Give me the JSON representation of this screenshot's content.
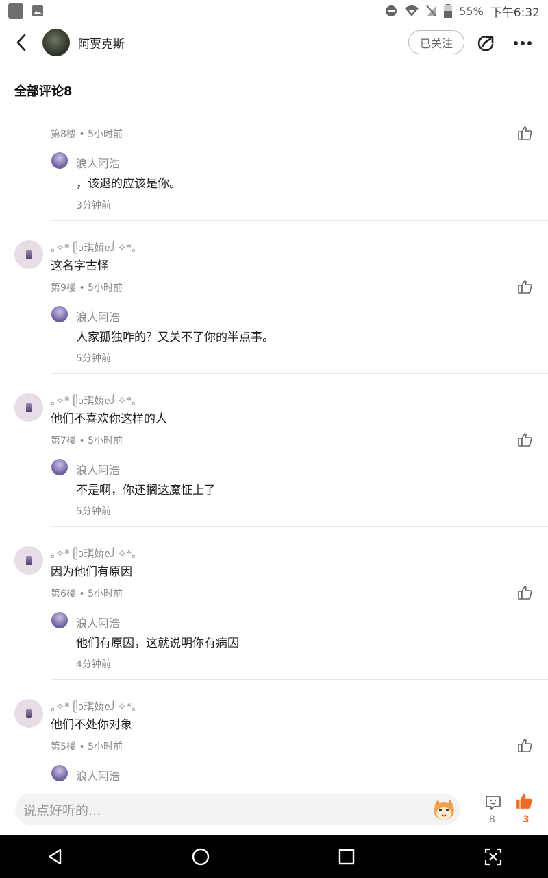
{
  "status_bar": {
    "battery": "55%",
    "time": "下午6:32"
  },
  "header": {
    "username": "阿贾克斯",
    "follow_label": "已关注"
  },
  "section_title": "全部评论8",
  "comments": [
    {
      "user": "",
      "text": "",
      "meta": "第8楼 • 5小时前",
      "reply": {
        "user": "浪人阿浩",
        "text": "，该退的应该是你。",
        "time": "3分钟前"
      }
    },
    {
      "user": "｡✧* ᥫᩣ琪娇ᩓ ✧*｡",
      "text": "这名字古怪",
      "meta": "第9楼 • 5小时前",
      "reply": {
        "user": "浪人阿浩",
        "text": "人家孤独咋的？又关不了你的半点事。",
        "time": "5分钟前"
      }
    },
    {
      "user": "｡✧* ᥫᩣ琪娇ᩓ ✧*｡",
      "text": "他们不喜欢你这样的人",
      "meta": "第7楼 • 5小时前",
      "reply": {
        "user": "浪人阿浩",
        "text": "不是啊，你还搁这魔怔上了",
        "time": "5分钟前"
      }
    },
    {
      "user": "｡✧* ᥫᩣ琪娇ᩓ ✧*｡",
      "text": "因为他们有原因",
      "meta": "第6楼 • 5小时前",
      "reply": {
        "user": "浪人阿浩",
        "text": "他们有原因，这就说明你有病因",
        "time": "4分钟前"
      }
    },
    {
      "user": "｡✧* ᥫᩣ琪娇ᩓ ✧*｡",
      "text": "他们不处你对象",
      "meta": "第5楼 • 5小时前",
      "reply": {
        "user": "浪人阿浩",
        "text": "",
        "time": ""
      }
    }
  ],
  "bottom_bar": {
    "input_placeholder": "说点好听的...",
    "comment_count": "8",
    "like_count": "3"
  },
  "colors": {
    "accent": "#f06a1f",
    "divider": "#e6e6e6"
  },
  "icons": [
    "back-arrow-icon",
    "share-icon",
    "more-icon",
    "thumbs-up-icon",
    "emoji-icon",
    "comment-icon",
    "nav-back-icon",
    "nav-home-icon",
    "nav-recents-icon",
    "nav-screenshot-icon"
  ]
}
